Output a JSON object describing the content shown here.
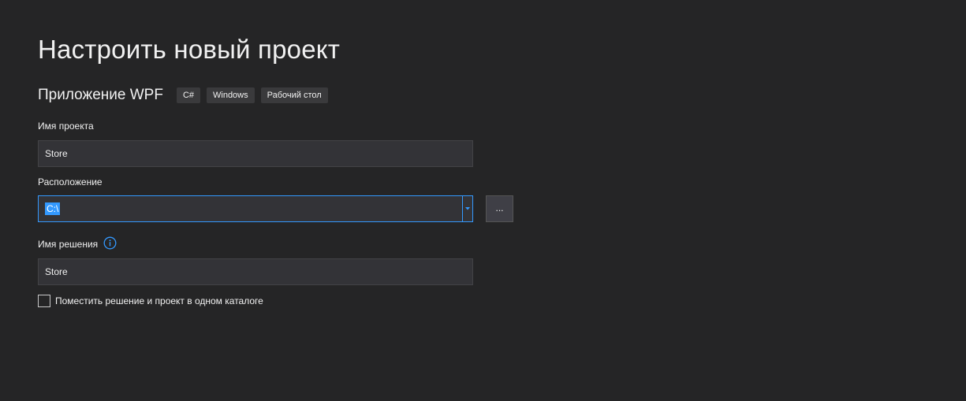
{
  "header": {
    "title": "Настроить новый проект"
  },
  "template": {
    "name": "Приложение WPF",
    "tags": [
      "C#",
      "Windows",
      "Рабочий стол"
    ]
  },
  "project_name": {
    "label": "Имя проекта",
    "value": "Store"
  },
  "location": {
    "label": "Расположение",
    "value": "C:\\",
    "browse_label": "..."
  },
  "solution_name": {
    "label": "Имя решения",
    "value": "Store",
    "info_icon": "info-icon"
  },
  "same_directory": {
    "label": "Поместить решение и проект в одном каталоге",
    "checked": false
  },
  "colors": {
    "background": "#252526",
    "field_background": "#333337",
    "focus_accent": "#3399ff",
    "tag_background": "#3a3a3c"
  }
}
